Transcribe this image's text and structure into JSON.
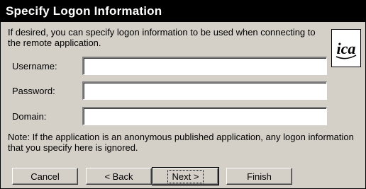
{
  "dialog": {
    "title": "Specify Logon Information",
    "intro": "If desired, you can specify logon information to be used when connecting to the remote application.",
    "logo_text": "ica",
    "note": "Note: If the application is an anonymous published application, any logon information that you specify here is ignored."
  },
  "fields": {
    "username": {
      "label": "Username:",
      "value": ""
    },
    "password": {
      "label": "Password:",
      "value": ""
    },
    "domain": {
      "label": "Domain:",
      "value": ""
    }
  },
  "buttons": {
    "cancel": "Cancel",
    "back": "< Back",
    "next": "Next >",
    "finish": "Finish"
  },
  "colors": {
    "titlebar_bg": "#000000",
    "window_bg": "#d4d0c8"
  }
}
